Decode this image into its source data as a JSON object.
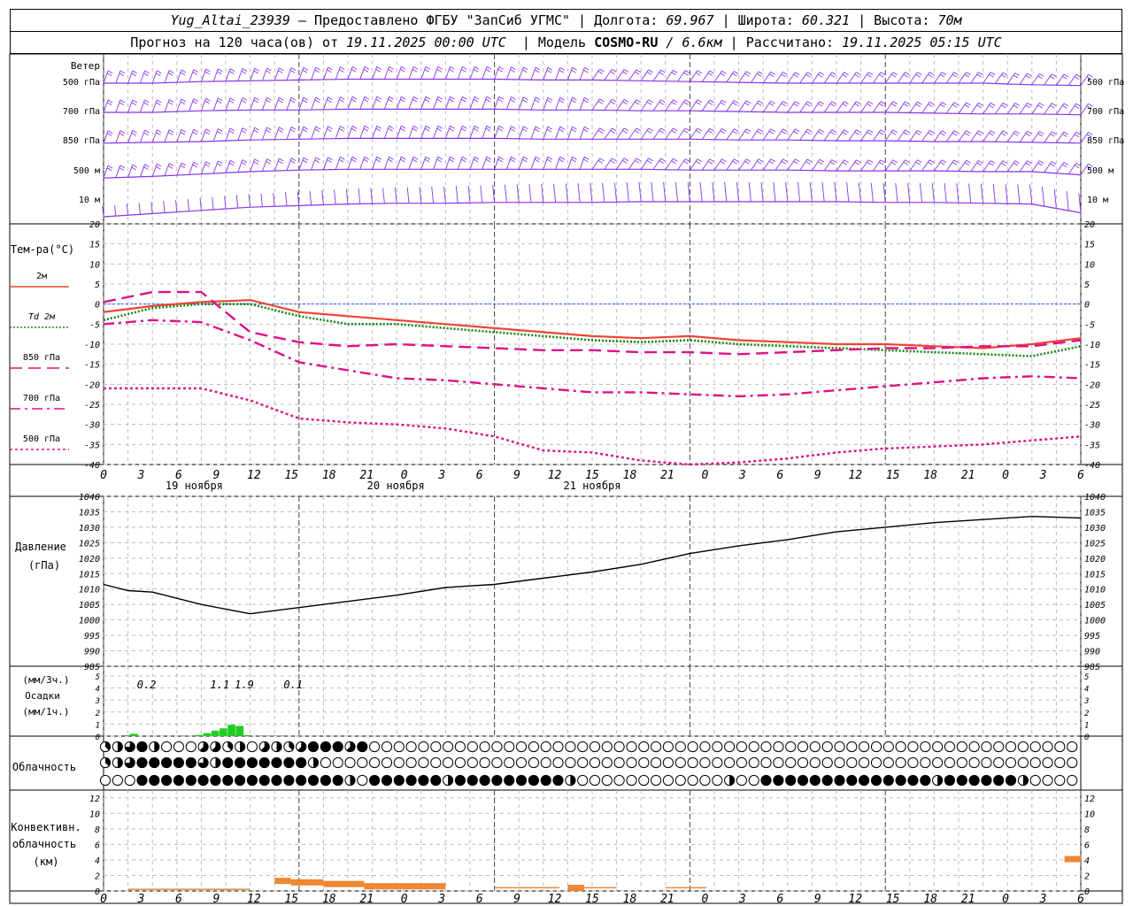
{
  "header": {
    "station": "Yug_Altai_23939",
    "provider": "– Предоставлено ФГБУ \"ЗапСиб УГМС\"",
    "lon_label": "| Долгота:",
    "lon_value": "69.967",
    "lat_label": "| Широта:",
    "lat_value": "60.321",
    "alt_label": "| Высота:",
    "alt_value": "70м",
    "forecast_prefix": "Прогноз на 120 часа(ов) от",
    "forecast_start": "19.11.2025 00:00 UTC",
    "model_label": "| Модель",
    "model_name": "COSMO-RU",
    "model_res": "/ 6.6км",
    "calc_label": "| Рассчитано:",
    "calc_time": "19.11.2025 05:15 UTC"
  },
  "panels": {
    "wind": {
      "title": "Ветер",
      "levels": [
        "500 гПа",
        "700 гПа",
        "850 гПа",
        "500 м",
        "10 м"
      ]
    },
    "temp": {
      "title": "Тем-ра(°C)",
      "legend": [
        {
          "label": "2м",
          "color": "#ee4433",
          "style": "solid"
        },
        {
          "label": "Td 2м",
          "color": "#118811",
          "style": "dotted"
        },
        {
          "label": "850 гПа",
          "color": "#dd1188",
          "style": "dash"
        },
        {
          "label": "700 гПа",
          "color": "#dd1188",
          "style": "dashdot"
        },
        {
          "label": "500 гПа",
          "color": "#dd1188",
          "style": "dot"
        }
      ]
    },
    "pressure": {
      "title": "Давление",
      "unit": "(гПа)"
    },
    "precip": {
      "unit_top": "(мм/3ч.)",
      "title": "Осадки",
      "unit_bottom": "(мм/1ч.)"
    },
    "cloud": {
      "title": "Облачность"
    },
    "convective": {
      "title1": "Конвективн.",
      "title2": "облачность",
      "unit": "(км)"
    }
  },
  "axis": {
    "hour_ticks": [
      "0",
      "3",
      "6",
      "9",
      "12",
      "15",
      "18",
      "21",
      "0",
      "3",
      "6",
      "9",
      "12",
      "15",
      "18",
      "21",
      "0",
      "3",
      "6",
      "9",
      "12",
      "15",
      "18",
      "21",
      "0",
      "3",
      "6"
    ],
    "days": [
      "19 ноября",
      "20 ноября",
      "21 ноября"
    ]
  },
  "colors": {
    "wind": "#8833ee",
    "t2m": "#ee4433",
    "td2m": "#118811",
    "upper": "#dd1188",
    "pressure": "#000000",
    "precip": "#22cc22",
    "precip_small": "#2233aa",
    "convective": "#ee8833",
    "zero_line": "#3355ff"
  },
  "chart_data": [
    {
      "type": "wind_barbs",
      "x_hours": [
        0,
        12,
        24,
        36,
        48,
        60,
        72,
        84,
        96,
        108,
        120
      ],
      "levels": [
        "500 гПа",
        "700 гПа",
        "850 гПа",
        "500 м",
        "10 м"
      ]
    },
    {
      "type": "line",
      "xlabel": "",
      "ylabel": "Тем-ра(°C)",
      "ylim": [
        -40,
        20
      ],
      "x": [
        0,
        6,
        12,
        18,
        24,
        30,
        36,
        42,
        48,
        54,
        60,
        66,
        72,
        78,
        84,
        90,
        96,
        102,
        108,
        114,
        120
      ],
      "series": [
        {
          "name": "2м",
          "values": [
            -2,
            -0.5,
            0.5,
            1,
            -2,
            -3,
            -4,
            -5,
            -6,
            -7,
            -8,
            -8.5,
            -8,
            -9,
            -9.5,
            -10,
            -10,
            -10.5,
            -11,
            -10,
            -8.5
          ]
        },
        {
          "name": "Td 2м",
          "values": [
            -4,
            -1,
            0,
            0,
            -3,
            -5,
            -5,
            -6,
            -7,
            -8,
            -9,
            -9.5,
            -9,
            -10,
            -10.5,
            -11,
            -11.5,
            -12,
            -12.5,
            -13,
            -10.5
          ]
        },
        {
          "name": "850 гПа",
          "values": [
            0.5,
            3,
            3,
            -7,
            -9.5,
            -10.5,
            -10,
            -10.5,
            -11,
            -11.5,
            -11.5,
            -12,
            -12,
            -12.5,
            -12,
            -11.5,
            -11,
            -11,
            -10.5,
            -10.5,
            -9
          ]
        },
        {
          "name": "700 гПа",
          "values": [
            -5,
            -4,
            -4.5,
            -9,
            -14.5,
            -16.5,
            -18.5,
            -19,
            -20,
            -21,
            -22,
            -22,
            -22.5,
            -23,
            -22.5,
            -21.5,
            -20.5,
            -19.5,
            -18.5,
            -18,
            -18.5
          ]
        },
        {
          "name": "500 гПа",
          "values": [
            -21,
            -21,
            -21,
            -24,
            -28.5,
            -29.5,
            -30,
            -31,
            -33,
            -36.5,
            -37,
            -39,
            -41,
            -39.5,
            -38.5,
            -37,
            -36,
            -35.5,
            -35,
            -34,
            -33
          ]
        }
      ],
      "yticks": [
        20,
        15,
        10,
        5,
        0,
        -5,
        -10,
        -15,
        -20,
        -25,
        -30,
        -35,
        -40
      ]
    },
    {
      "type": "line",
      "ylabel": "Давление",
      "ylim": [
        985,
        1040
      ],
      "x": [
        0,
        3,
        6,
        12,
        18,
        24,
        30,
        36,
        42,
        48,
        54,
        60,
        66,
        72,
        78,
        84,
        90,
        96,
        102,
        108,
        114,
        120
      ],
      "series": [
        {
          "name": "Давление",
          "values": [
            1011.5,
            1009.5,
            1009,
            1005,
            1002,
            1004,
            1006,
            1008,
            1010.5,
            1011.5,
            1013.5,
            1015.5,
            1018,
            1021.5,
            1024,
            1026,
            1028.5,
            1030,
            1031.5,
            1032.5,
            1033.5,
            1033
          ]
        }
      ],
      "yticks": [
        1040,
        1035,
        1030,
        1025,
        1020,
        1015,
        1010,
        1005,
        1000,
        995,
        990,
        985
      ]
    },
    {
      "type": "bar",
      "ylabel": "Осадки",
      "ylim": [
        0,
        5
      ],
      "x": [
        3,
        4,
        10,
        12,
        13,
        14,
        15,
        16,
        17,
        18,
        20,
        21,
        22
      ],
      "values": [
        0.05,
        0.2,
        0.03,
        0.1,
        0.25,
        0.45,
        0.65,
        0.95,
        0.85,
        0.08,
        0.03,
        0.03,
        0.03
      ],
      "three_hour_totals": [
        {
          "hour": 3,
          "label": "0.2"
        },
        {
          "hour": 12,
          "label": "1.1"
        },
        {
          "hour": 15,
          "label": "1.9"
        },
        {
          "hour": 21,
          "label": "0.1"
        }
      ]
    },
    {
      "type": "bar",
      "ylabel": "Конвективн. облачность",
      "ylim": [
        0,
        13
      ],
      "segments": [
        {
          "from": 3,
          "to": 9,
          "value": 0.3
        },
        {
          "from": 9,
          "to": 18,
          "value": 0.3
        },
        {
          "from": 21,
          "to": 23,
          "value": 1.7
        },
        {
          "from": 23,
          "to": 27,
          "value": 1.5
        },
        {
          "from": 27,
          "to": 32,
          "value": 1.3
        },
        {
          "from": 32,
          "to": 42,
          "value": 1
        },
        {
          "from": 48,
          "to": 56,
          "value": 0.5
        },
        {
          "from": 57,
          "to": 59,
          "value": 0.8
        },
        {
          "from": 59,
          "to": 63,
          "value": 0.5
        },
        {
          "from": 69,
          "to": 74,
          "value": 0.5
        },
        {
          "from": 118,
          "to": 120,
          "value": 4.5
        }
      ],
      "yticks": [
        12,
        10,
        8,
        6,
        4,
        2,
        0
      ]
    },
    {
      "type": "table",
      "name": "cloud_cover_eighths",
      "rows": [
        {
          "layer": "top",
          "values": [
            3,
            4,
            6,
            8,
            4,
            0,
            0,
            0,
            5,
            5,
            3,
            4,
            0,
            5,
            4,
            3,
            5,
            8,
            8,
            8,
            5,
            8,
            0,
            0,
            0,
            0,
            0,
            0,
            0,
            0,
            0,
            0,
            0,
            0,
            0,
            0,
            0,
            0,
            0,
            0,
            0,
            0,
            0,
            0,
            0,
            0,
            0,
            0,
            0,
            0,
            0,
            0,
            0,
            0,
            0,
            0,
            0,
            0,
            0,
            0,
            0,
            0,
            0,
            0,
            0,
            0,
            0,
            0,
            0,
            0,
            0,
            0,
            0,
            0,
            0,
            0,
            0,
            0,
            0,
            0,
            0,
            0,
            0,
            0,
            0,
            0,
            0,
            0,
            0,
            0,
            0,
            0,
            0,
            0,
            0,
            0,
            0,
            0,
            0,
            0,
            0,
            0,
            0,
            0,
            0,
            0,
            0,
            0,
            0,
            0,
            0,
            0,
            0,
            0,
            0,
            0,
            0,
            0,
            0,
            0,
            0,
            3,
            0,
            4,
            0,
            3,
            0,
            3,
            4
          ]
        },
        {
          "layer": "mid",
          "values": [
            3,
            4,
            6,
            8,
            8,
            8,
            8,
            8,
            6,
            4,
            8,
            8,
            8,
            8,
            8,
            8,
            8,
            4,
            0,
            0,
            0,
            0,
            0,
            0,
            0,
            0,
            0,
            0,
            0,
            0,
            0,
            0,
            0,
            0,
            0,
            0,
            0,
            0,
            0,
            0,
            0,
            0,
            0,
            0,
            0,
            0,
            0,
            0,
            0,
            0,
            0,
            0,
            0,
            0,
            0,
            0,
            0,
            0,
            0,
            0,
            0,
            0,
            0,
            0,
            0,
            0,
            0,
            0,
            0,
            0,
            0,
            0,
            0,
            0,
            0,
            0,
            0,
            0,
            0,
            0,
            0,
            0,
            0,
            0,
            0,
            0,
            0,
            0,
            0,
            0,
            0,
            0,
            0,
            0,
            0,
            0,
            0,
            0,
            0,
            0,
            0,
            0,
            0,
            0,
            0,
            0,
            0,
            0,
            0,
            0,
            0,
            0,
            0,
            0,
            0,
            0,
            0,
            0,
            0,
            0,
            0,
            3,
            0,
            4,
            0,
            3,
            6,
            8,
            8
          ]
        },
        {
          "layer": "low",
          "values": [
            0,
            0,
            0,
            8,
            8,
            8,
            8,
            8,
            8,
            8,
            8,
            8,
            8,
            8,
            8,
            8,
            8,
            8,
            8,
            8,
            4,
            0,
            8,
            8,
            8,
            8,
            8,
            8,
            4,
            8,
            8,
            8,
            8,
            8,
            8,
            8,
            8,
            8,
            4,
            0,
            0,
            0,
            0,
            0,
            0,
            0,
            0,
            0,
            0,
            0,
            0,
            4,
            0,
            0,
            8,
            8,
            8,
            8,
            8,
            8,
            8,
            8,
            8,
            8,
            8,
            8,
            8,
            8,
            4,
            8,
            8,
            8,
            8,
            8,
            8,
            4,
            0,
            0,
            0,
            0,
            0,
            0,
            0,
            0,
            0,
            0,
            0,
            0,
            0,
            0,
            0,
            0,
            0,
            0,
            0,
            0,
            0,
            0,
            0,
            0,
            0,
            0,
            0,
            0,
            0,
            0,
            0,
            0,
            0,
            0,
            0,
            0,
            0,
            0,
            0,
            0,
            0,
            0,
            0,
            0,
            0,
            0,
            0,
            0,
            0,
            0,
            0,
            0,
            0
          ]
        }
      ]
    }
  ]
}
